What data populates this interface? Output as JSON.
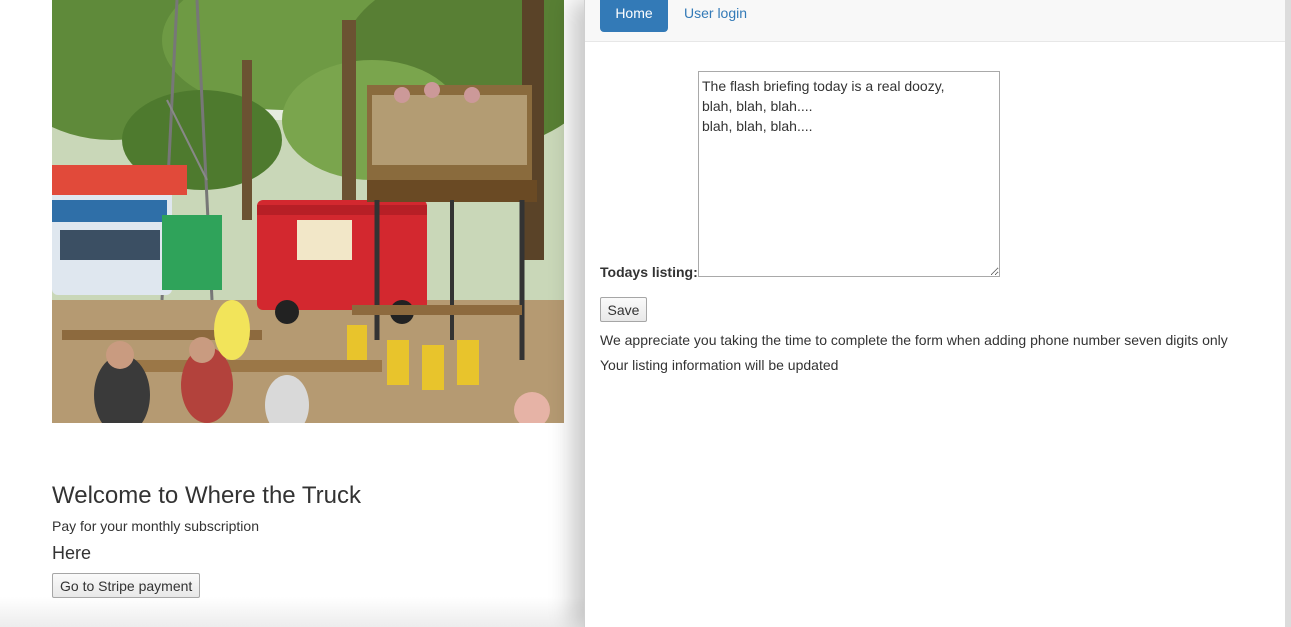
{
  "left": {
    "image_alt": "Food trucks in an outdoor park",
    "welcome_title": "Welcome to Where the Truck",
    "subscription_text": "Pay for your monthly subscription",
    "here_text": "Here",
    "stripe_button_label": "Go to Stripe payment"
  },
  "nav": {
    "home_label": "Home",
    "login_label": "User login"
  },
  "form": {
    "listing_label": "Todays listing:",
    "listing_value": "The flash briefing today is a real doozy,\nblah, blah, blah....\nblah, blah, blah....",
    "save_label": "Save",
    "phone_note": "We appreciate you taking the time to complete the form when adding phone number seven digits only",
    "update_note": "Your listing information will be updated"
  },
  "colors": {
    "accent": "#337ab7",
    "text": "#333333",
    "navbar_bg": "#f8f8f8"
  }
}
